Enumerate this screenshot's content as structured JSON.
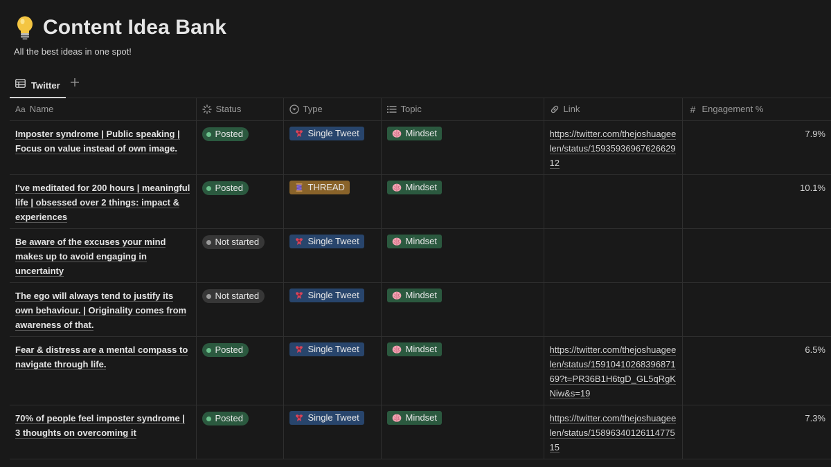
{
  "page": {
    "title": "Content Idea Bank",
    "subtitle": "All the best ideas in one spot!",
    "icon": "lightbulb-icon"
  },
  "tabs": [
    {
      "label": "Twitter",
      "icon": "table-icon",
      "active": true
    }
  ],
  "table": {
    "columns": [
      {
        "label": "Name",
        "icon": "aa-text-icon"
      },
      {
        "label": "Status",
        "icon": "status-spinner-icon"
      },
      {
        "label": "Type",
        "icon": "select-circle-icon"
      },
      {
        "label": "Topic",
        "icon": "list-icon"
      },
      {
        "label": "Link",
        "icon": "link-icon"
      },
      {
        "label": "Engagement %",
        "icon": "hash-icon"
      }
    ],
    "rows": [
      {
        "name": "Imposter syndrome | Public speaking | Focus on value instead of own image.",
        "status": "Posted",
        "type": "Single Tweet",
        "topic": "Mindset",
        "link": "https://twitter.com/thejoshuageelen/status/1593593696762662912",
        "engagement": "7.9%"
      },
      {
        "name": "I've meditated for 200 hours | meaningful life | obsessed over 2 things: impact & experiences",
        "status": "Posted",
        "type": "THREAD",
        "topic": "Mindset",
        "link": "",
        "engagement": "10.1%"
      },
      {
        "name": "Be aware of the excuses your mind makes up to avoid engaging in uncertainty",
        "status": "Not started",
        "type": "Single Tweet",
        "topic": "Mindset",
        "link": "",
        "engagement": ""
      },
      {
        "name": "The ego will always tend to justify its own behaviour. | Originality comes from awareness of that.",
        "status": "Not started",
        "type": "Single Tweet",
        "topic": "Mindset",
        "link": "",
        "engagement": ""
      },
      {
        "name": "Fear & distress are a mental compass to navigate through life.",
        "status": "Posted",
        "type": "Single Tweet",
        "topic": "Mindset",
        "link": "https://twitter.com/thejoshuageelen/status/1591041026839687169?t=PR36B1H6tgD_GL5qRgKNiw&s=19",
        "engagement": "6.5%"
      },
      {
        "name": "70% of people feel imposter syndrome | 3 thoughts on overcoming it",
        "status": "Posted",
        "type": "Single Tweet",
        "topic": "Mindset",
        "link": "https://twitter.com/thejoshuageelen/status/1589634012611477515",
        "engagement": "7.3%"
      }
    ]
  },
  "colors": {
    "background": "#191919",
    "posted_tag": "#2b593f",
    "not_started_tag": "#373737",
    "single_tweet_tag": "#28456c",
    "thread_tag": "#89632a",
    "mindset_tag": "#2b593f"
  }
}
